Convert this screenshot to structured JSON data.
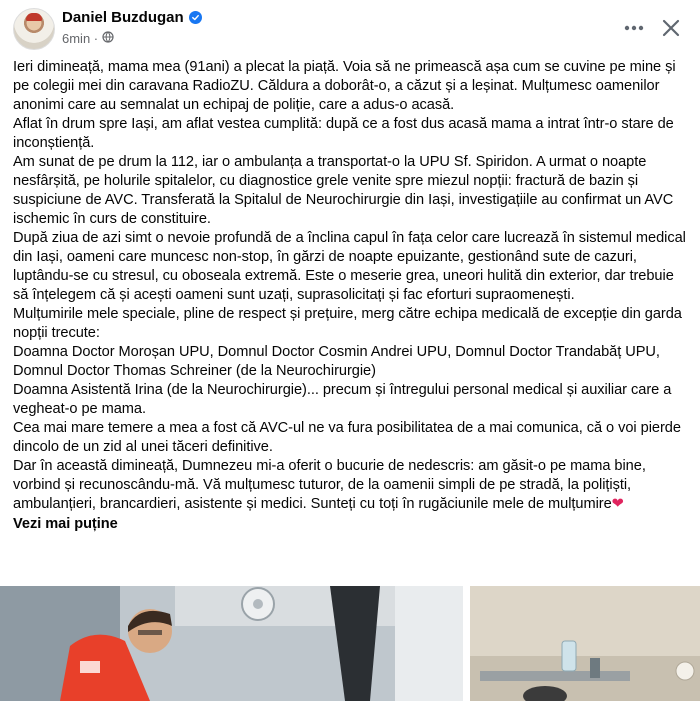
{
  "post": {
    "author": "Daniel Buzdugan",
    "time": "6min ·",
    "paragraphs": [
      "Ieri dimineață, mama mea (91ani) a plecat la piață. Voia să ne primească așa cum se cuvine pe mine și pe colegii mei din caravana RadioZU. Căldura a doborât-o, a căzut și a leșinat. Mulțumesc oamenilor anonimi care au semnalat un echipaj de poliție, care a adus-o acasă.",
      "Aflat în drum spre Iași, am aflat vestea cumplită: după ce a fost dus acasă mama a intrat într-o stare de inconștiență.",
      "Am sunat de pe drum la 112, iar o ambulanța a transportat-o la UPU Sf. Spiridon. A urmat o noapte nesfârșită, pe holurile spitalelor, cu diagnostice grele venite spre miezul nopții: fractură de bazin și suspiciune de AVC. Transferată la Spitalul de Neurochirurgie din Iași, investigațiile au confirmat un AVC ischemic în curs de constituire.",
      "După ziua de azi simt o nevoie profundă de a înclina capul în fața celor care lucrează în sistemul medical din Iași, oameni care muncesc non-stop, în gărzi de noapte epuizante, gestionând sute de cazuri, luptându-se cu stresul, cu oboseala extremă.  Este o meserie grea, uneori  hulită din exterior, dar trebuie să înțelegem că și acești oameni sunt uzați, suprasolicitați și fac eforturi supraomenești.",
      "Mulțumirile mele speciale, pline de respect și prețuire, merg către echipa medicală de excepție din garda nopții trecute:",
      "Doamna Doctor Moroșan UPU, Domnul Doctor Cosmin Andrei UPU, Domnul Doctor Trandabăț UPU, Domnul Doctor Thomas Schreiner (de la Neurochirurgie)",
      "Doamna Asistentă Irina (de la Neurochirurgie)... precum și întregului personal medical și auxiliar care a vegheat-o pe mama.",
      "Cea mai mare temere a mea a fost că AVC-ul ne va fura posibilitatea de a mai comunica, că o voi pierde dincolo de un zid al unei tăceri definitive.",
      "Dar în această dimineață, Dumnezeu mi-a oferit o bucurie de nedescris: am găsit-o pe mama bine, vorbind și recunoscându-mă. Vă mulțumesc tuturor, de la oamenii simpli de pe stradă, la polițiști, ambulanțieri, brancardieri, asistente și medici. Sunteți cu toți în rugăciunile mele de mulțumire"
    ],
    "heart": "❤",
    "see_less": "Vezi mai puține"
  },
  "icons": {
    "verified": "verified-badge-icon",
    "audience": "globe-icon",
    "more": "more-options-icon",
    "close": "close-icon"
  },
  "colors": {
    "verified": "#1877f2",
    "meta": "#65676b",
    "ambulance_uniform": "#e8402a"
  }
}
